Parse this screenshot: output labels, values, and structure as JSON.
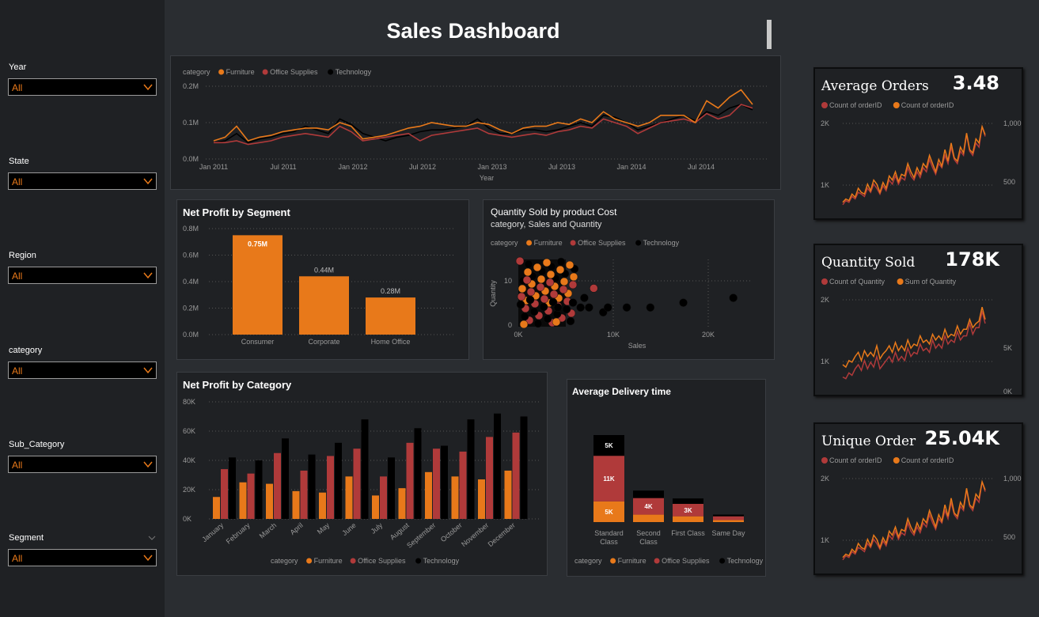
{
  "title": "Sales Dashboard",
  "colors": {
    "furniture": "#e8791a",
    "office_supplies": "#b03a3a",
    "technology": "#000000",
    "panel": "#1f2124",
    "background": "#2a2d31"
  },
  "filters": [
    {
      "label": "Year",
      "value": "All"
    },
    {
      "label": "State",
      "value": "All"
    },
    {
      "label": "Region",
      "value": "All"
    },
    {
      "label": "category",
      "value": "All"
    },
    {
      "label": "Sub_Category",
      "value": "All"
    },
    {
      "label": "Segment",
      "value": "All"
    }
  ],
  "chart_data": [
    {
      "id": "sales-trend",
      "type": "line",
      "legend_title": "category",
      "legend": [
        "Furniture",
        "Office Supplies",
        "Technology"
      ],
      "xlabel": "Year",
      "xticks": [
        "Jan 2011",
        "Jul 2011",
        "Jan 2012",
        "Jul 2012",
        "Jan 2013",
        "Jul 2013",
        "Jan 2014",
        "Jul 2014"
      ],
      "yticks": [
        "0.0M",
        "0.1M",
        "0.2M"
      ],
      "ylim": [
        0,
        0.2
      ],
      "series": [
        {
          "name": "Technology",
          "values": [
            0.045,
            0.05,
            0.07,
            0.045,
            0.055,
            0.06,
            0.07,
            0.075,
            0.09,
            0.08,
            0.07,
            0.11,
            0.095,
            0.07,
            0.06,
            0.05,
            0.06,
            0.065,
            0.075,
            0.08,
            0.08,
            0.085,
            0.09,
            0.11,
            0.085,
            0.07,
            0.07,
            0.08,
            0.08,
            0.075,
            0.08,
            0.09,
            0.1,
            0.09,
            0.12,
            0.115,
            0.1,
            0.08,
            0.09,
            0.1,
            0.11,
            0.12,
            0.105,
            0.13,
            0.12,
            0.14,
            0.15,
            0.135
          ]
        },
        {
          "name": "Office Supplies",
          "values": [
            0.045,
            0.045,
            0.05,
            0.04,
            0.045,
            0.05,
            0.06,
            0.065,
            0.07,
            0.065,
            0.06,
            0.09,
            0.075,
            0.05,
            0.055,
            0.06,
            0.065,
            0.07,
            0.05,
            0.065,
            0.07,
            0.075,
            0.08,
            0.085,
            0.07,
            0.065,
            0.06,
            0.065,
            0.07,
            0.065,
            0.075,
            0.08,
            0.09,
            0.085,
            0.11,
            0.1,
            0.09,
            0.07,
            0.085,
            0.1,
            0.105,
            0.11,
            0.1,
            0.125,
            0.11,
            0.12,
            0.15,
            0.14
          ]
        },
        {
          "name": "Furniture",
          "values": [
            0.05,
            0.06,
            0.09,
            0.05,
            0.06,
            0.065,
            0.075,
            0.08,
            0.085,
            0.085,
            0.08,
            0.1,
            0.09,
            0.055,
            0.06,
            0.065,
            0.075,
            0.085,
            0.09,
            0.1,
            0.095,
            0.09,
            0.09,
            0.1,
            0.095,
            0.08,
            0.07,
            0.085,
            0.09,
            0.09,
            0.1,
            0.095,
            0.11,
            0.1,
            0.13,
            0.11,
            0.1,
            0.09,
            0.1,
            0.12,
            0.12,
            0.12,
            0.1,
            0.16,
            0.14,
            0.17,
            0.19,
            0.15
          ]
        }
      ]
    },
    {
      "id": "profit-by-segment",
      "type": "bar",
      "title": "Net  Profit by Segment",
      "categories": [
        "Consumer",
        "Corporate",
        "Home Office"
      ],
      "values": [
        0.75,
        0.44,
        0.28
      ],
      "labels": [
        "0.75M",
        "0.44M",
        "0.28M"
      ],
      "yticks": [
        "0.0M",
        "0.2M",
        "0.4M",
        "0.6M",
        "0.8M"
      ],
      "ylim": [
        0,
        0.8
      ]
    },
    {
      "id": "qty-by-cost",
      "type": "scatter",
      "title": "Quantity  Sold by product Cost",
      "subtitle": "category, Sales and Quantity",
      "legend_title": "category",
      "legend": [
        "Furniture",
        "Office Supplies",
        "Technology"
      ],
      "xlabel": "Sales",
      "ylabel": "Quantity",
      "xticks": [
        "0K",
        "10K",
        "20K"
      ],
      "yticks": [
        "0",
        "10"
      ],
      "xlim": [
        0,
        24000
      ],
      "ylim": [
        0,
        14
      ],
      "outliers": [
        [
          4200,
          4
        ],
        [
          5800,
          5
        ],
        [
          6600,
          4
        ],
        [
          7000,
          6
        ],
        [
          7500,
          4
        ],
        [
          8000,
          8
        ],
        [
          9000,
          3
        ],
        [
          9500,
          4
        ],
        [
          11500,
          4
        ],
        [
          14000,
          4
        ],
        [
          17500,
          5
        ],
        [
          22800,
          6
        ]
      ]
    },
    {
      "id": "profit-by-category",
      "type": "bar",
      "title": "Net  Profit by Category",
      "legend_title": "category",
      "legend": [
        "Furniture",
        "Office Supplies",
        "Technology"
      ],
      "categories": [
        "January",
        "February",
        "March",
        "April",
        "May",
        "June",
        "July",
        "August",
        "September",
        "October",
        "November",
        "December"
      ],
      "yticks": [
        "0K",
        "20K",
        "40K",
        "60K",
        "80K"
      ],
      "ylim": [
        0,
        80000
      ],
      "series": [
        {
          "name": "Furniture",
          "values": [
            15000,
            25000,
            24000,
            19000,
            18000,
            29000,
            16000,
            21000,
            32000,
            29000,
            27000,
            33000
          ]
        },
        {
          "name": "Office Supplies",
          "values": [
            34000,
            31000,
            45000,
            33000,
            43000,
            48000,
            29000,
            52000,
            48000,
            46000,
            56000,
            59000
          ]
        },
        {
          "name": "Technology",
          "values": [
            42000,
            40000,
            55000,
            44000,
            52000,
            68000,
            42000,
            62000,
            50000,
            68000,
            72000,
            70000
          ]
        }
      ]
    },
    {
      "id": "delivery-time",
      "type": "bar",
      "stacked": true,
      "title": "Average Delivery time",
      "legend_title": "category",
      "legend": [
        "Furniture",
        "Office Supplies",
        "Technology"
      ],
      "categories": [
        "Standard Class",
        "Second Class",
        "First Class",
        "Same Day"
      ],
      "series": [
        {
          "name": "Furniture",
          "values": [
            5000,
            1800,
            1400,
            500
          ],
          "labels": [
            "5K",
            "",
            "",
            ""
          ]
        },
        {
          "name": "Office Supplies",
          "values": [
            11000,
            4000,
            3000,
            900
          ],
          "labels": [
            "11K",
            "4K",
            "3K",
            ""
          ]
        },
        {
          "name": "Technology",
          "values": [
            5000,
            1800,
            1300,
            400
          ],
          "labels": [
            "5K",
            "",
            "",
            ""
          ]
        }
      ]
    }
  ],
  "kpi_cards": [
    {
      "title": "Average Orders",
      "value": "3.48",
      "legend": [
        "Count of orderID",
        "Count of orderID"
      ],
      "left_ticks": [
        "2K",
        "1K"
      ],
      "right_ticks": [
        "1,000",
        "500"
      ],
      "series_a": [
        0.05,
        0.1,
        0.08,
        0.15,
        0.12,
        0.2,
        0.18,
        0.15,
        0.25,
        0.2,
        0.3,
        0.25,
        0.18,
        0.28,
        0.22,
        0.35,
        0.3,
        0.4,
        0.3,
        0.38,
        0.35,
        0.5,
        0.4,
        0.35,
        0.45,
        0.38,
        0.5,
        0.45,
        0.6,
        0.5,
        0.42,
        0.55,
        0.5,
        0.65,
        0.55,
        0.75,
        0.6,
        0.55,
        0.7,
        0.65,
        0.9,
        0.7,
        0.65,
        0.8,
        0.75,
        1.0,
        0.88
      ],
      "series_b": [
        0.08,
        0.12,
        0.1,
        0.18,
        0.14,
        0.25,
        0.2,
        0.18,
        0.3,
        0.22,
        0.35,
        0.3,
        0.2,
        0.32,
        0.25,
        0.4,
        0.35,
        0.45,
        0.33,
        0.42,
        0.4,
        0.55,
        0.45,
        0.38,
        0.5,
        0.42,
        0.55,
        0.5,
        0.65,
        0.55,
        0.45,
        0.6,
        0.52,
        0.72,
        0.58,
        0.8,
        0.62,
        0.58,
        0.75,
        0.68,
        0.92,
        0.72,
        0.68,
        0.85,
        0.8,
        1.0,
        0.9
      ]
    },
    {
      "title": "Quantity Sold",
      "value": "178K",
      "legend": [
        "Count of Quantity",
        "Sum of Quantity"
      ],
      "left_ticks": [
        "2K",
        "1K"
      ],
      "right_ticks": [
        "5K",
        "0K"
      ],
      "series_a": [
        0.1,
        0.08,
        0.15,
        0.12,
        0.2,
        0.25,
        0.18,
        0.3,
        0.2,
        0.28,
        0.22,
        0.35,
        0.2,
        0.25,
        0.3,
        0.35,
        0.28,
        0.4,
        0.3,
        0.35,
        0.3,
        0.45,
        0.35,
        0.4,
        0.38,
        0.5,
        0.42,
        0.45,
        0.4,
        0.55,
        0.45,
        0.5,
        0.45,
        0.6,
        0.5,
        0.55,
        0.52,
        0.65,
        0.55,
        0.6,
        0.6,
        0.75,
        0.62,
        0.7,
        0.7,
        0.9,
        0.75
      ],
      "series_b": [
        0.25,
        0.22,
        0.3,
        0.28,
        0.35,
        0.4,
        0.3,
        0.42,
        0.35,
        0.4,
        0.35,
        0.48,
        0.32,
        0.38,
        0.42,
        0.48,
        0.4,
        0.52,
        0.42,
        0.48,
        0.42,
        0.55,
        0.45,
        0.5,
        0.48,
        0.6,
        0.52,
        0.55,
        0.5,
        0.62,
        0.55,
        0.6,
        0.55,
        0.68,
        0.58,
        0.62,
        0.6,
        0.72,
        0.62,
        0.68,
        0.68,
        0.8,
        0.7,
        0.75,
        0.78,
        0.95,
        0.8
      ]
    },
    {
      "title": "Unique Order",
      "value": "25.04K",
      "legend": [
        "Count of orderID",
        "Count of orderID"
      ],
      "left_ticks": [
        "2K",
        "1K"
      ],
      "right_ticks": [
        "1,000",
        "500"
      ],
      "series_a": [
        0.05,
        0.1,
        0.08,
        0.15,
        0.12,
        0.2,
        0.18,
        0.15,
        0.25,
        0.2,
        0.3,
        0.25,
        0.18,
        0.28,
        0.22,
        0.35,
        0.3,
        0.4,
        0.3,
        0.38,
        0.35,
        0.5,
        0.4,
        0.35,
        0.45,
        0.38,
        0.5,
        0.45,
        0.6,
        0.5,
        0.42,
        0.55,
        0.5,
        0.65,
        0.55,
        0.75,
        0.6,
        0.55,
        0.7,
        0.65,
        0.9,
        0.7,
        0.65,
        0.8,
        0.75,
        1.0,
        0.88
      ],
      "series_b": [
        0.08,
        0.12,
        0.1,
        0.18,
        0.14,
        0.25,
        0.2,
        0.18,
        0.3,
        0.22,
        0.35,
        0.3,
        0.2,
        0.32,
        0.25,
        0.4,
        0.35,
        0.45,
        0.33,
        0.42,
        0.4,
        0.55,
        0.45,
        0.38,
        0.5,
        0.42,
        0.55,
        0.5,
        0.65,
        0.55,
        0.45,
        0.6,
        0.52,
        0.72,
        0.58,
        0.8,
        0.62,
        0.58,
        0.75,
        0.68,
        0.92,
        0.72,
        0.68,
        0.85,
        0.8,
        1.0,
        0.9
      ]
    }
  ]
}
